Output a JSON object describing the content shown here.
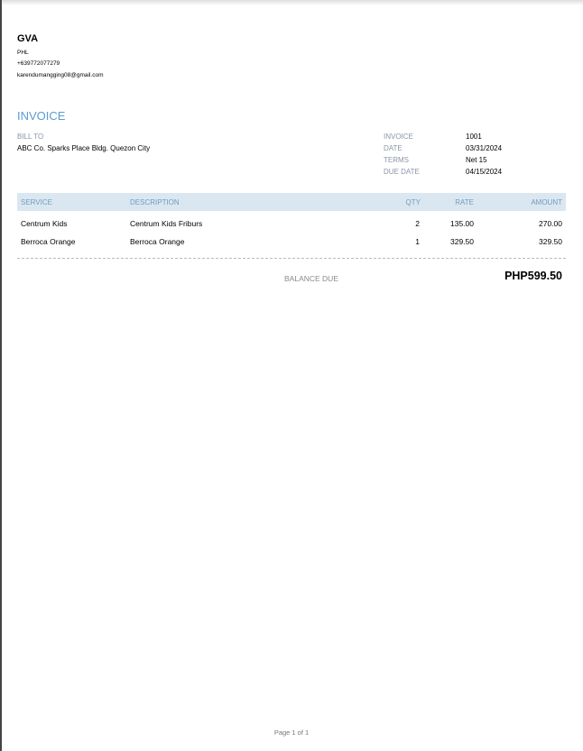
{
  "sender": {
    "name": "GVA",
    "country": "PHL",
    "phone": "+639772077279",
    "email": "karendumangging08@gmail.com"
  },
  "title": "INVOICE",
  "bill_to": {
    "label": "BILL TO",
    "value": "ABC Co. Sparks Place Bldg. Quezon City"
  },
  "meta": [
    {
      "label": "INVOICE",
      "value": "1001"
    },
    {
      "label": "DATE",
      "value": "03/31/2024"
    },
    {
      "label": "TERMS",
      "value": "Net 15"
    },
    {
      "label": "DUE DATE",
      "value": "04/15/2024"
    }
  ],
  "table": {
    "headers": {
      "service": "SERVICE",
      "description": "DESCRIPTION",
      "qty": "QTY",
      "rate": "RATE",
      "amount": "AMOUNT"
    },
    "rows": [
      {
        "service": "Centrum Kids",
        "description": "Centrum Kids Friburs",
        "qty": "2",
        "rate": "135.00",
        "amount": "270.00"
      },
      {
        "service": "Berroca Orange",
        "description": "Berroca Orange",
        "qty": "1",
        "rate": "329.50",
        "amount": "329.50"
      }
    ]
  },
  "balance": {
    "label": "BALANCE DUE",
    "value": "PHP599.50"
  },
  "footer": "Page 1 of 1"
}
